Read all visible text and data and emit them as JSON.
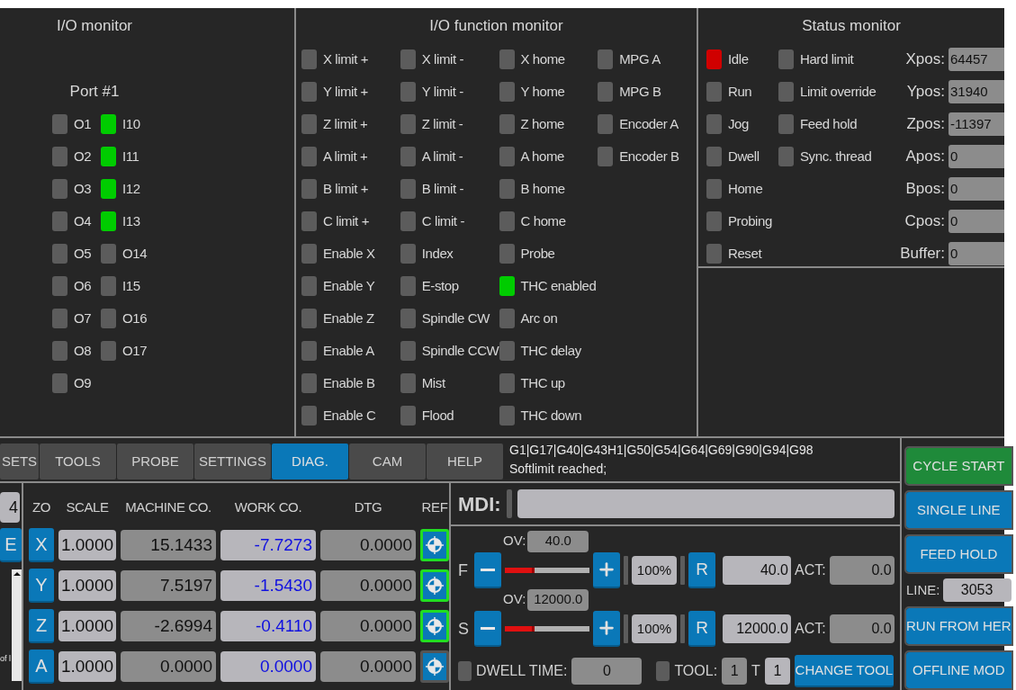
{
  "io_monitor": {
    "title": "I/O monitor",
    "port": "Port #1",
    "columns": [
      [
        {
          "label": "O1",
          "on": false
        },
        {
          "label": "O2",
          "on": false
        },
        {
          "label": "O3",
          "on": false
        },
        {
          "label": "O4",
          "on": false
        },
        {
          "label": "O5",
          "on": false
        },
        {
          "label": "O6",
          "on": false
        },
        {
          "label": "O7",
          "on": false
        },
        {
          "label": "O8",
          "on": false
        },
        {
          "label": "O9",
          "on": false
        }
      ],
      [
        {
          "label": "I10",
          "on": true,
          "color": "#00cc00"
        },
        {
          "label": "I11",
          "on": true,
          "color": "#00cc00"
        },
        {
          "label": "I12",
          "on": true,
          "color": "#00cc00"
        },
        {
          "label": "I13",
          "on": true,
          "color": "#00cc00"
        },
        {
          "label": "O14",
          "on": false
        },
        {
          "label": "I15",
          "on": false
        },
        {
          "label": "O16",
          "on": false
        },
        {
          "label": "O17",
          "on": false
        }
      ]
    ]
  },
  "io_function_monitor": {
    "title": "I/O function monitor",
    "columns": [
      [
        {
          "label": "X limit +",
          "on": false
        },
        {
          "label": "Y limit +",
          "on": false
        },
        {
          "label": "Z limit +",
          "on": false
        },
        {
          "label": "A limit +",
          "on": false
        },
        {
          "label": "B limit +",
          "on": false
        },
        {
          "label": "C limit +",
          "on": false
        },
        {
          "label": "Enable X",
          "on": false
        },
        {
          "label": "Enable Y",
          "on": false
        },
        {
          "label": "Enable Z",
          "on": false
        },
        {
          "label": "Enable A",
          "on": false
        },
        {
          "label": "Enable B",
          "on": false
        },
        {
          "label": "Enable C",
          "on": false
        }
      ],
      [
        {
          "label": "X limit -",
          "on": false
        },
        {
          "label": "Y limit -",
          "on": false
        },
        {
          "label": "Z limit -",
          "on": false
        },
        {
          "label": "A limit -",
          "on": false
        },
        {
          "label": "B limit -",
          "on": false
        },
        {
          "label": "C limit -",
          "on": false
        },
        {
          "label": "Index",
          "on": false
        },
        {
          "label": "E-stop",
          "on": false
        },
        {
          "label": "Spindle CW",
          "on": false
        },
        {
          "label": "Spindle CCW",
          "on": false
        },
        {
          "label": "Mist",
          "on": false
        },
        {
          "label": "Flood",
          "on": false
        }
      ],
      [
        {
          "label": "X home",
          "on": false
        },
        {
          "label": "Y home",
          "on": false
        },
        {
          "label": "Z home",
          "on": false
        },
        {
          "label": "A home",
          "on": false
        },
        {
          "label": "B home",
          "on": false
        },
        {
          "label": "C home",
          "on": false
        },
        {
          "label": "Probe",
          "on": false
        },
        {
          "label": "THC enabled",
          "on": true,
          "color": "#00cc00"
        },
        {
          "label": "Arc on",
          "on": false
        },
        {
          "label": "THC delay",
          "on": false
        },
        {
          "label": "THC up",
          "on": false
        },
        {
          "label": "THC down",
          "on": false
        }
      ],
      [
        {
          "label": "MPG A",
          "on": false
        },
        {
          "label": "MPG B",
          "on": false
        },
        {
          "label": "Encoder A",
          "on": false
        },
        {
          "label": "Encoder B",
          "on": false
        }
      ]
    ]
  },
  "status_monitor": {
    "title": "Status monitor",
    "columns": [
      [
        {
          "label": "Idle",
          "on": true,
          "color": "#d00000"
        },
        {
          "label": "Run",
          "on": false
        },
        {
          "label": "Jog",
          "on": false
        },
        {
          "label": "Dwell",
          "on": false
        },
        {
          "label": "Home",
          "on": false
        },
        {
          "label": "Probing",
          "on": false
        },
        {
          "label": "Reset",
          "on": false
        }
      ],
      [
        {
          "label": "Hard limit",
          "on": false
        },
        {
          "label": "Limit override",
          "on": false
        },
        {
          "label": "Feed hold",
          "on": false
        },
        {
          "label": "Sync. thread",
          "on": false
        }
      ]
    ],
    "positions": [
      {
        "label": "Xpos:",
        "value": "64457"
      },
      {
        "label": "Ypos:",
        "value": "31940"
      },
      {
        "label": "Zpos:",
        "value": "-11397"
      },
      {
        "label": "Apos:",
        "value": "0"
      },
      {
        "label": "Bpos:",
        "value": "0"
      },
      {
        "label": "Cpos:",
        "value": "0"
      },
      {
        "label": "Buffer:",
        "value": "0"
      }
    ]
  },
  "tabs": [
    {
      "label": "SETS",
      "selected": false
    },
    {
      "label": "TOOLS",
      "selected": false
    },
    {
      "label": "PROBE",
      "selected": false
    },
    {
      "label": "SETTINGS",
      "selected": false
    },
    {
      "label": "DIAG.",
      "selected": true
    },
    {
      "label": "CAM",
      "selected": false
    },
    {
      "label": "HELP",
      "selected": false
    }
  ],
  "gcode_state": "G1|G17|G40|G43H1|G50|G54|G64|G69|G90|G94|G98",
  "message": "Softlimit reached;",
  "left_strip": {
    "field_value": "4",
    "button_label": "E",
    "text": "of l"
  },
  "axes_table": {
    "columns": [
      "ZO",
      "SCALE",
      "MACHINE CO.",
      "WORK CO.",
      "DTG",
      "REF"
    ],
    "rows": [
      {
        "axis": "X",
        "scale": "1.0000",
        "machine": "15.1433",
        "work": "-7.7273",
        "dtg": "0.0000",
        "referenced": true
      },
      {
        "axis": "Y",
        "scale": "1.0000",
        "machine": "7.5197",
        "work": "-1.5430",
        "dtg": "0.0000",
        "referenced": true
      },
      {
        "axis": "Z",
        "scale": "1.0000",
        "machine": "-2.6994",
        "work": "-0.4110",
        "dtg": "0.0000",
        "referenced": true
      },
      {
        "axis": "A",
        "scale": "1.0000",
        "machine": "0.0000",
        "work": "0.0000",
        "dtg": "0.0000",
        "referenced": false
      }
    ]
  },
  "mdi": {
    "label": "MDI:"
  },
  "overrides": [
    {
      "letter": "F",
      "ov_label": "OV:",
      "ov_value": "40.0",
      "level": 0.35,
      "percent": "100%",
      "reset": "R",
      "value": "40.0",
      "act_label": "ACT:",
      "act_value": "0.0"
    },
    {
      "letter": "S",
      "ov_label": "OV:",
      "ov_value": "12000.0",
      "level": 0.35,
      "percent": "100%",
      "reset": "R",
      "value": "12000.0",
      "act_label": "ACT:",
      "act_value": "0.0"
    }
  ],
  "dwell": {
    "on": false,
    "label": "DWELL TIME:",
    "value": "0"
  },
  "tool": {
    "on": false,
    "label": "TOOL:",
    "value": "1",
    "t_label": "T",
    "t_value": "1"
  },
  "change_tool": "CHANGE TOOL",
  "right_panel": [
    {
      "kind": "button",
      "label": "CYCLE START",
      "color": "#1f8a3a"
    },
    {
      "kind": "button",
      "label": "SINGLE LINE",
      "color": "#0a78b8"
    },
    {
      "kind": "button",
      "label": "FEED HOLD",
      "color": "#0a78b8"
    },
    {
      "kind": "field",
      "label": "LINE:",
      "value": "3053"
    },
    {
      "kind": "button",
      "label": "RUN FROM HER",
      "color": "#0a78b8"
    },
    {
      "kind": "button",
      "label": "OFFLINE MOD",
      "color": "#0a78b8"
    }
  ]
}
